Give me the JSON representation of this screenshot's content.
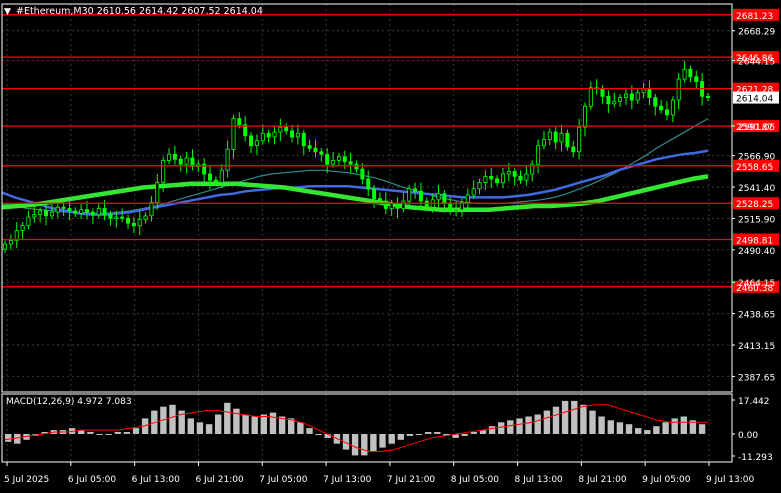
{
  "header": {
    "symbol_line": "#Ethereum,M30  2610.56 2614.42 2607.52 2614.04"
  },
  "colors": {
    "background": "#000000",
    "grid": "#3a3a3a",
    "axis_text": "#ffffff",
    "candle_up": "#00ff00",
    "candle_down": "#00ff00",
    "level_line": "#ff0000",
    "level_label_bg": "#ff0000",
    "ma_fast": "#2e8b8b",
    "ma_mid": "#4169e1",
    "ma_slow": "#32e632",
    "macd_hist": "#c0c0c0",
    "macd_signal": "#ff0000",
    "current_price_bg": "#ffffff"
  },
  "price_axis": {
    "ticks": [
      "2668.29",
      "2644.15",
      "2591.05",
      "2566.90",
      "2541.40",
      "2515.90",
      "2490.40",
      "2464.15",
      "2438.65",
      "2413.15",
      "2387.65"
    ]
  },
  "levels": [
    {
      "price": 2681.23,
      "label": "2681.23"
    },
    {
      "price": 2646.86,
      "label": "2646.86"
    },
    {
      "price": 2621.28,
      "label": "2621.28"
    },
    {
      "price": 2590.87,
      "label": "2590.87"
    },
    {
      "price": 2558.65,
      "label": "2558.65"
    },
    {
      "price": 2528.25,
      "label": "2528.25"
    },
    {
      "price": 2498.81,
      "label": "2498.81"
    },
    {
      "price": 2460.38,
      "label": "2460.38"
    }
  ],
  "current_price": {
    "price": 2614.04,
    "label": "2614.04"
  },
  "time_axis": {
    "labels": [
      "5 Jul 2025",
      "6 Jul 05:00",
      "6 Jul 13:00",
      "6 Jul 21:00",
      "7 Jul 05:00",
      "7 Jul 13:00",
      "7 Jul 21:00",
      "8 Jul 05:00",
      "8 Jul 13:00",
      "8 Jul 21:00",
      "9 Jul 05:00",
      "9 Jul 13:00"
    ]
  },
  "macd": {
    "label": "MACD(12,26,9) 4.972 7.083",
    "ticks": [
      "17.442",
      "0.00",
      "-11.293"
    ]
  },
  "chart_data": {
    "type": "candlestick",
    "ylim": [
      2375,
      2690
    ],
    "close": [
      2495,
      2498,
      2506,
      2510,
      2517,
      2519,
      2522,
      2518,
      2521,
      2525,
      2524,
      2522,
      2520,
      2523,
      2521,
      2519,
      2524,
      2519,
      2516,
      2517,
      2516,
      2512,
      2510,
      2515,
      2518,
      2529,
      2545,
      2563,
      2568,
      2564,
      2560,
      2565,
      2558,
      2560,
      2552,
      2547,
      2545,
      2555,
      2572,
      2597,
      2592,
      2583,
      2575,
      2579,
      2585,
      2582,
      2586,
      2590,
      2587,
      2582,
      2585,
      2575,
      2573,
      2570,
      2568,
      2560,
      2563,
      2566,
      2562,
      2560,
      2556,
      2548,
      2540,
      2532,
      2530,
      2524,
      2528,
      2524,
      2530,
      2540,
      2538,
      2530,
      2525,
      2531,
      2536,
      2528,
      2522,
      2523,
      2529,
      2535,
      2540,
      2545,
      2550,
      2548,
      2545,
      2552,
      2554,
      2550,
      2547,
      2552,
      2560,
      2575,
      2580,
      2586,
      2578,
      2585,
      2574,
      2570,
      2590,
      2607,
      2622,
      2621,
      2615,
      2609,
      2611,
      2614,
      2617,
      2612,
      2618,
      2621,
      2614,
      2607,
      2604,
      2600,
      2612,
      2629,
      2637,
      2631,
      2627,
      2615,
      2614
    ],
    "series": [
      {
        "name": "MA fast",
        "values": [
          2528,
          2526,
          2524,
          2523,
          2522,
          2521,
          2521,
          2520,
          2520,
          2521,
          2522,
          2524,
          2526,
          2529,
          2532,
          2535,
          2538,
          2541,
          2544,
          2547,
          2550,
          2552,
          2553,
          2554,
          2555,
          2555,
          2554,
          2553,
          2551,
          2549,
          2546,
          2542,
          2539,
          2536,
          2533,
          2531,
          2529,
          2528,
          2528,
          2528,
          2529,
          2530,
          2531,
          2533,
          2536,
          2540,
          2544,
          2549,
          2554,
          2560,
          2566,
          2573,
          2579,
          2585,
          2591,
          2597
        ]
      },
      {
        "name": "MA mid",
        "values": [
          2537,
          2533,
          2530,
          2527,
          2524,
          2522,
          2520,
          2519,
          2519,
          2520,
          2521,
          2523,
          2525,
          2527,
          2529,
          2531,
          2533,
          2535,
          2536,
          2538,
          2539,
          2540,
          2541,
          2541,
          2542,
          2542,
          2542,
          2542,
          2541,
          2540,
          2539,
          2538,
          2537,
          2536,
          2535,
          2534,
          2533,
          2533,
          2533,
          2533,
          2534,
          2535,
          2537,
          2539,
          2542,
          2545,
          2548,
          2551,
          2555,
          2558,
          2561,
          2564,
          2566,
          2568,
          2569,
          2571
        ]
      },
      {
        "name": "MA slow",
        "values": [
          2525,
          2526,
          2527,
          2529,
          2531,
          2533,
          2535,
          2537,
          2539,
          2541,
          2542,
          2543,
          2544,
          2544,
          2544,
          2544,
          2543,
          2542,
          2541,
          2539,
          2537,
          2535,
          2533,
          2531,
          2529,
          2527,
          2525,
          2524,
          2523,
          2523,
          2523,
          2523,
          2524,
          2525,
          2526,
          2526,
          2527,
          2528,
          2530,
          2533,
          2536,
          2539,
          2542,
          2545,
          2548,
          2550
        ]
      },
      {
        "name": "MACD histogram",
        "values": [
          -4,
          -5,
          -3,
          -1,
          1,
          2,
          2,
          3,
          2,
          1,
          0,
          0,
          1,
          1,
          3,
          8,
          12,
          14,
          15,
          12,
          8,
          6,
          5,
          10,
          16,
          13,
          10,
          9,
          10,
          11,
          9,
          8,
          6,
          3,
          0,
          -2,
          -5,
          -8,
          -11,
          -11,
          -9,
          -7,
          -5,
          -3,
          -1,
          0,
          1,
          1,
          -1,
          -2,
          -1,
          1,
          2,
          4,
          6,
          7,
          8,
          9,
          10,
          12,
          14,
          17,
          17,
          15,
          12,
          9,
          7,
          6,
          5,
          3,
          2,
          4,
          6,
          8,
          9,
          7,
          5
        ]
      },
      {
        "name": "MACD signal",
        "values": [
          -3,
          -2,
          -1,
          0,
          1,
          1,
          2,
          2,
          2,
          2,
          3,
          4,
          6,
          8,
          10,
          11,
          12,
          12,
          11,
          10,
          9,
          9,
          8,
          7,
          5,
          2,
          -1,
          -4,
          -7,
          -9,
          -9,
          -8,
          -6,
          -4,
          -2,
          -1,
          0,
          1,
          2,
          3,
          4,
          5,
          6,
          8,
          10,
          12,
          14,
          15,
          15,
          13,
          11,
          9,
          7,
          6,
          6,
          6,
          6
        ]
      }
    ]
  }
}
